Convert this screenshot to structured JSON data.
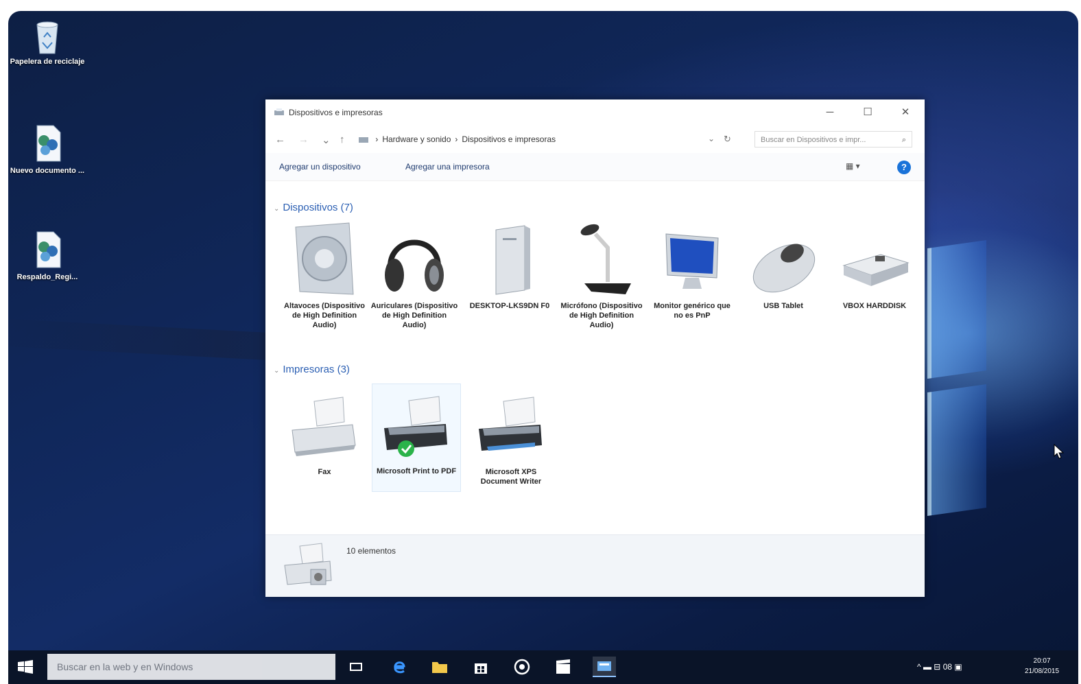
{
  "desktop": {
    "icons": [
      {
        "label": "Papelera de reciclaje",
        "icon": "recycle-bin-icon"
      },
      {
        "label": "Nuevo documento ...",
        "icon": "document-icon"
      },
      {
        "label": "Respaldo_Regi...",
        "icon": "document-icon"
      }
    ]
  },
  "window": {
    "title": "Dispositivos e impresoras",
    "controls": {
      "minimize": "─",
      "maximize": "☐",
      "close": "✕"
    },
    "nav": {
      "back": "←",
      "forward": "→",
      "recent": "⌄",
      "up": "↑",
      "refresh": "↻",
      "dropdown": "⌄"
    },
    "breadcrumb": [
      "Hardware y sonido",
      "Dispositivos e impresoras"
    ],
    "breadcrumb_sep": "›",
    "search_placeholder": "Buscar en Dispositivos e impr...",
    "commands": {
      "add_device": "Agregar un dispositivo",
      "add_printer": "Agregar una impresora"
    },
    "view_icon": "▦ ▾",
    "help_label": "?",
    "devices_header": "Dispositivos (7)",
    "devices": [
      {
        "label": "Altavoces (Dispositivo de High Definition Audio)",
        "icon": "speaker-icon"
      },
      {
        "label": "Auriculares (Dispositivo de High Definition Audio)",
        "icon": "headphones-icon"
      },
      {
        "label": "DESKTOP-LKS9DN F0",
        "icon": "computer-icon"
      },
      {
        "label": "Micrófono (Dispositivo de High Definition Audio)",
        "icon": "microphone-icon"
      },
      {
        "label": "Monitor genérico que no es PnP",
        "icon": "monitor-icon"
      },
      {
        "label": "USB Tablet",
        "icon": "mouse-icon"
      },
      {
        "label": "VBOX HARDDISK",
        "icon": "harddisk-icon"
      }
    ],
    "printers_header": "Impresoras (3)",
    "printers": [
      {
        "label": "Fax",
        "icon": "fax-icon"
      },
      {
        "label": "Microsoft Print to PDF",
        "icon": "printer-icon"
      },
      {
        "label": "Microsoft XPS Document Writer",
        "icon": "printer-icon"
      }
    ],
    "status": "10 elementos"
  },
  "taskbar": {
    "search_placeholder": "Buscar en la web y en Windows",
    "tray_text": "^ ▬ ⊟ 08 ▣",
    "time": "20:07",
    "date": "21/08/2015"
  }
}
